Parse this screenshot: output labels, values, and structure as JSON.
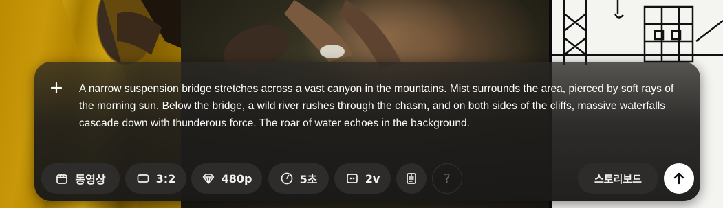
{
  "composer": {
    "prompt_text": "A narrow suspension bridge stretches across a vast canyon in the mountains. Mist surrounds the area, pierced by soft rays of the morning sun. Below the bridge, a wild river rushes through the chasm, and on both sides of the cliffs, massive waterfalls cascade down with thunderous force. The roar of water echoes in the background.",
    "add_label": "+"
  },
  "toolbar": {
    "mode_label": "동영상",
    "aspect_label": "3:2",
    "resolution_label": "480p",
    "duration_label": "5초",
    "variations_label": "2v",
    "help_label": "?",
    "storyboard_label": "스토리보드"
  },
  "icons": {
    "add": "plus-icon",
    "mode": "video-clapper-icon",
    "aspect": "aspect-ratio-icon",
    "resolution": "diamond-icon",
    "duration": "clock-icon",
    "variations": "variations-icon",
    "presets": "preset-list-icon",
    "send": "arrow-up-icon"
  },
  "colors": {
    "panel": "#1f1e1c",
    "chip": "#2d2c2a",
    "text": "#ffffff",
    "send_button": "#ffffff"
  }
}
